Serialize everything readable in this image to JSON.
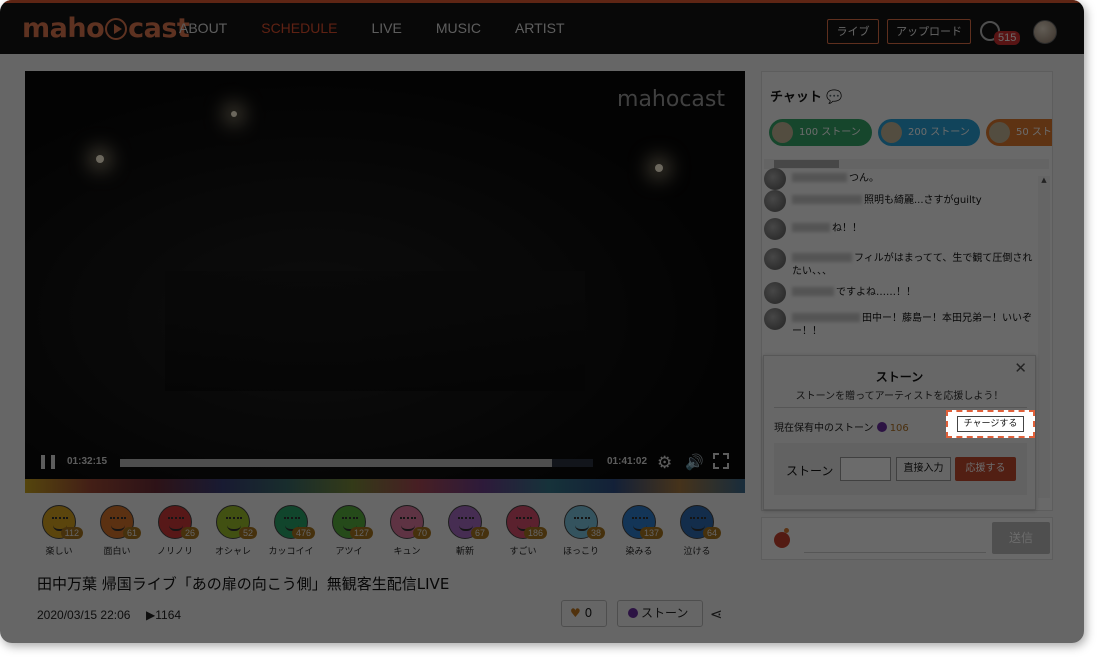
{
  "header": {
    "logo": "mahocast",
    "nav": [
      "ABOUT",
      "SCHEDULE",
      "LIVE",
      "MUSIC",
      "ARTIST"
    ],
    "active_nav": "SCHEDULE",
    "live_button": "ライブ",
    "upload_button": "アップロード",
    "notification_count": "515"
  },
  "player": {
    "watermark": "mahocast",
    "current_time": "01:32:15",
    "duration": "01:41:02",
    "progress_fraction": 0.913
  },
  "reactions": [
    {
      "label": "楽しい",
      "count": "112",
      "color": "#d9a420"
    },
    {
      "label": "面白い",
      "count": "61",
      "color": "#d8752c"
    },
    {
      "label": "ノリノリ",
      "count": "26",
      "color": "#cf3a3a"
    },
    {
      "label": "オシャレ",
      "count": "52",
      "color": "#9bbf2c"
    },
    {
      "label": "カッコイイ",
      "count": "476",
      "color": "#2aa56a"
    },
    {
      "label": "アツイ",
      "count": "127",
      "color": "#59b03f"
    },
    {
      "label": "キュン",
      "count": "70",
      "color": "#e07aa0"
    },
    {
      "label": "斬新",
      "count": "67",
      "color": "#a86cc4"
    },
    {
      "label": "すごい",
      "count": "186",
      "color": "#d94f6e"
    },
    {
      "label": "ほっこり",
      "count": "38",
      "color": "#7cc7e0"
    },
    {
      "label": "染みる",
      "count": "137",
      "color": "#2f7fd0"
    },
    {
      "label": "泣ける",
      "count": "64",
      "color": "#2e6db3"
    }
  ],
  "video": {
    "title": "田中万葉 帰国ライブ「あの扉の向こう側」無観客生配信LIVE",
    "date": "2020/03/15 22:06",
    "views": "1164",
    "likes": "0",
    "stone_label": "ストーン"
  },
  "chat": {
    "title": "チャット",
    "pills": [
      {
        "label": "100 ストーン",
        "color": "#35a86a"
      },
      {
        "label": "200 ストーン",
        "color": "#2aa3d8"
      },
      {
        "label": "50 スト",
        "color": "#e07a2e"
      }
    ],
    "messages": [
      {
        "text": "つん。"
      },
      {
        "text": "照明も綺麗...さすがguilty"
      },
      {
        "text": "ね！！"
      },
      {
        "text": "フィルがはまってて、生で観て圧倒されたい、、、"
      },
      {
        "text": "ですよね……！！"
      },
      {
        "text": "田中ー！藤島ー！本田兄弟ー！いいぞー！！"
      }
    ],
    "send_button": "送信"
  },
  "stone_panel": {
    "title": "ストーン",
    "subtitle": "ストーンを贈ってアーティストを応援しよう！",
    "owned_label": "現在保有中のストーン",
    "owned_amount": "106",
    "charge_button": "チャージする",
    "stone_field_label": "ストーン",
    "direct_input_button": "直接入力",
    "support_button": "応援する"
  }
}
